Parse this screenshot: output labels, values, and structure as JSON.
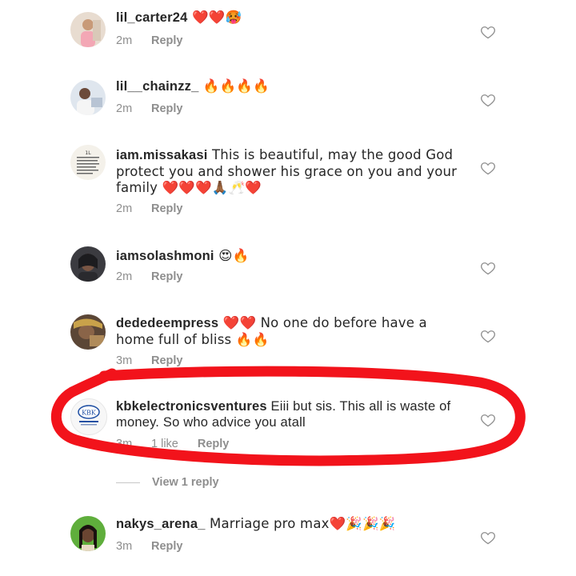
{
  "comments": [
    {
      "username": "lil_carter24",
      "text": " ❤️❤️🥵",
      "time": "2m",
      "reply_label": "Reply",
      "avatar_icon": "avatar-photo",
      "like_icon": "heart-outline-icon"
    },
    {
      "username": "lil__chainzz_",
      "text": " 🔥🔥🔥🔥",
      "time": "2m",
      "reply_label": "Reply",
      "avatar_icon": "avatar-photo",
      "like_icon": "heart-outline-icon"
    },
    {
      "username": "iam.missakasi",
      "text": " This is beautiful,  may the good God protect you and shower his grace on you and your family ❤️❤️❤️🙏🏾🥂❤️",
      "time": "2m",
      "reply_label": "Reply",
      "avatar_icon": "avatar-photo",
      "like_icon": "heart-outline-icon"
    },
    {
      "username": "iamsolashmoni",
      "text": " 😍🔥",
      "time": "2m",
      "reply_label": "Reply",
      "avatar_icon": "avatar-photo",
      "like_icon": "heart-outline-icon"
    },
    {
      "username": "dededeempress",
      "text": " ❤️❤️ No one do before have a home full of bliss 🔥🔥",
      "time": "3m",
      "reply_label": "Reply",
      "avatar_icon": "avatar-photo",
      "like_icon": "heart-outline-icon"
    },
    {
      "username": "kbkelectronicsventures",
      "text": " Eiii but sis. This all is waste of money. So who advice you atall",
      "time": "3m",
      "likes": "1 like",
      "reply_label": "Reply",
      "view_replies_label": "View 1 reply",
      "avatar_text": "KBK",
      "avatar_icon": "avatar-logo",
      "like_icon": "heart-outline-icon",
      "highlight_color": "#f2131b"
    },
    {
      "username": "nakys_arena_",
      "text": " Marriage pro max❤️🎉🎉🎉",
      "time": "3m",
      "reply_label": "Reply",
      "avatar_icon": "avatar-photo",
      "like_icon": "heart-outline-icon"
    }
  ],
  "colors": {
    "text": "#262626",
    "secondary": "#8e8e8e",
    "highlight": "#f2131b"
  }
}
